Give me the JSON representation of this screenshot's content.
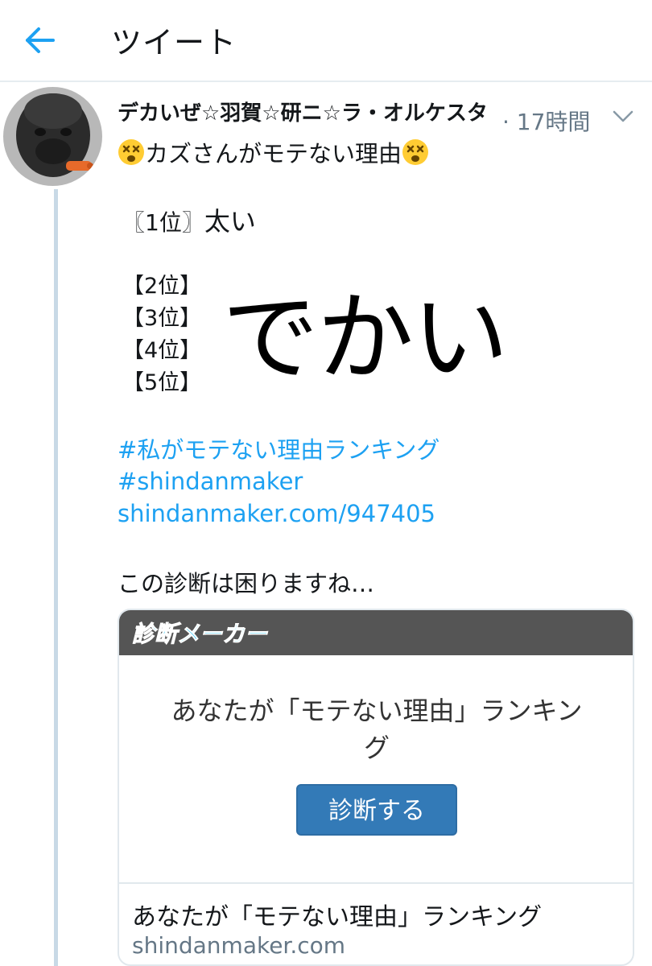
{
  "header": {
    "title": "ツイート"
  },
  "tweet": {
    "display_name": "デカいぜ☆羽賀☆研ニ☆ラ・オルケスタ",
    "timestamp": "· 17時間",
    "first_line": "カズさんがモテない理由",
    "rank1_label": "〖1位〗",
    "rank1_value": "太い",
    "ranks": [
      "【2位】",
      "【3位】",
      "【4位】",
      "【5位】"
    ],
    "ranks_value": "でかい",
    "hashtag1": "#私がモテない理由ランキング",
    "hashtag2": "#shindanmaker",
    "url": "shindanmaker.com/947405",
    "comment": "この診断は困りますね…"
  },
  "card": {
    "logo": "診断メーカー",
    "preview_title": "あなたが「モテない理由」ランキング",
    "button_label": "診断する",
    "title": "あなたが「モテない理由」ランキング",
    "domain": "shindanmaker.com"
  },
  "colors": {
    "accent": "#1da1f2",
    "button": "#337ab7",
    "banner": "#555555"
  }
}
